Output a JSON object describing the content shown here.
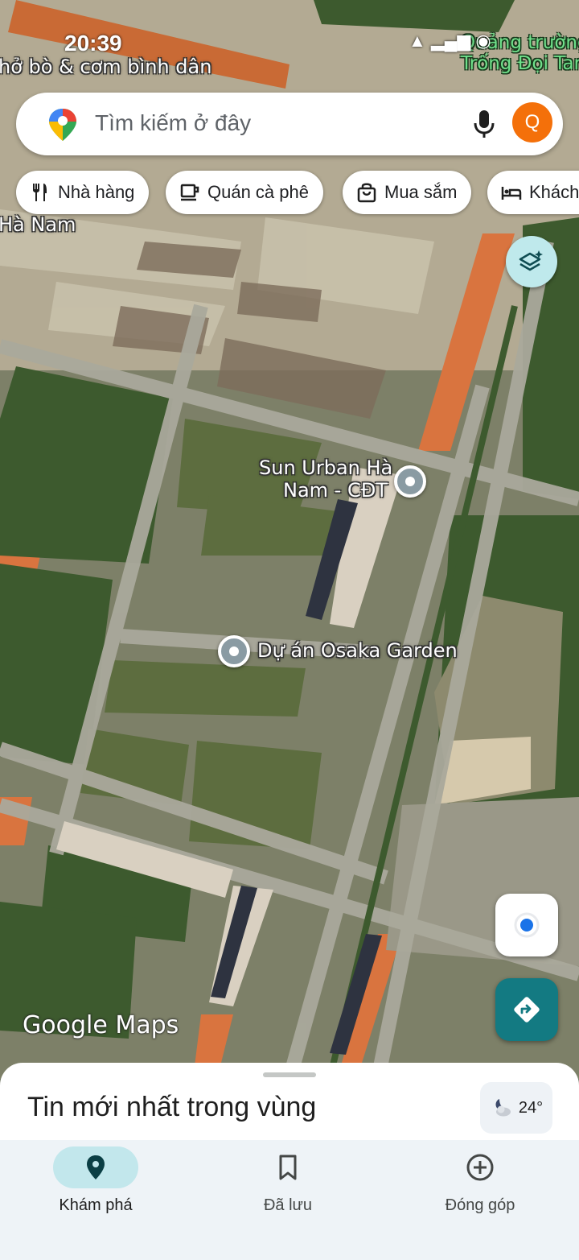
{
  "status_bar": {
    "time": "20:39",
    "icons": "▲ ▂▄▆ ◉"
  },
  "search": {
    "placeholder": "Tìm kiếm ở đây",
    "avatar_letter": "Q"
  },
  "chips": [
    {
      "label": "Nhà hàng",
      "icon": "fork-knife-icon"
    },
    {
      "label": "Quán cà phê",
      "icon": "coffee-cup-icon"
    },
    {
      "label": "Mua sắm",
      "icon": "shopping-bag-icon"
    },
    {
      "label": "Khách",
      "icon": "bed-icon"
    }
  ],
  "map": {
    "labels": {
      "top_left": "hở bò & cơm bình dân",
      "top_right_line1": "Quảng trường",
      "top_right_line2": "Trống Đọi Tam",
      "ha_nam": "Hà Nam",
      "sun_urban_line1": "Sun Urban Hà",
      "sun_urban_line2": "Nam - CĐT",
      "osaka": "Dự án Osaka Garden"
    },
    "brand": "Google Maps"
  },
  "bottom_sheet": {
    "title": "Tin mới nhất trong vùng",
    "weather": "24°"
  },
  "nav": [
    {
      "label": "Khám phá",
      "icon": "location-pin-icon",
      "active": true
    },
    {
      "label": "Đã lưu",
      "icon": "bookmark-icon",
      "active": false
    },
    {
      "label": "Đóng góp",
      "icon": "plus-circle-icon",
      "active": false
    }
  ]
}
